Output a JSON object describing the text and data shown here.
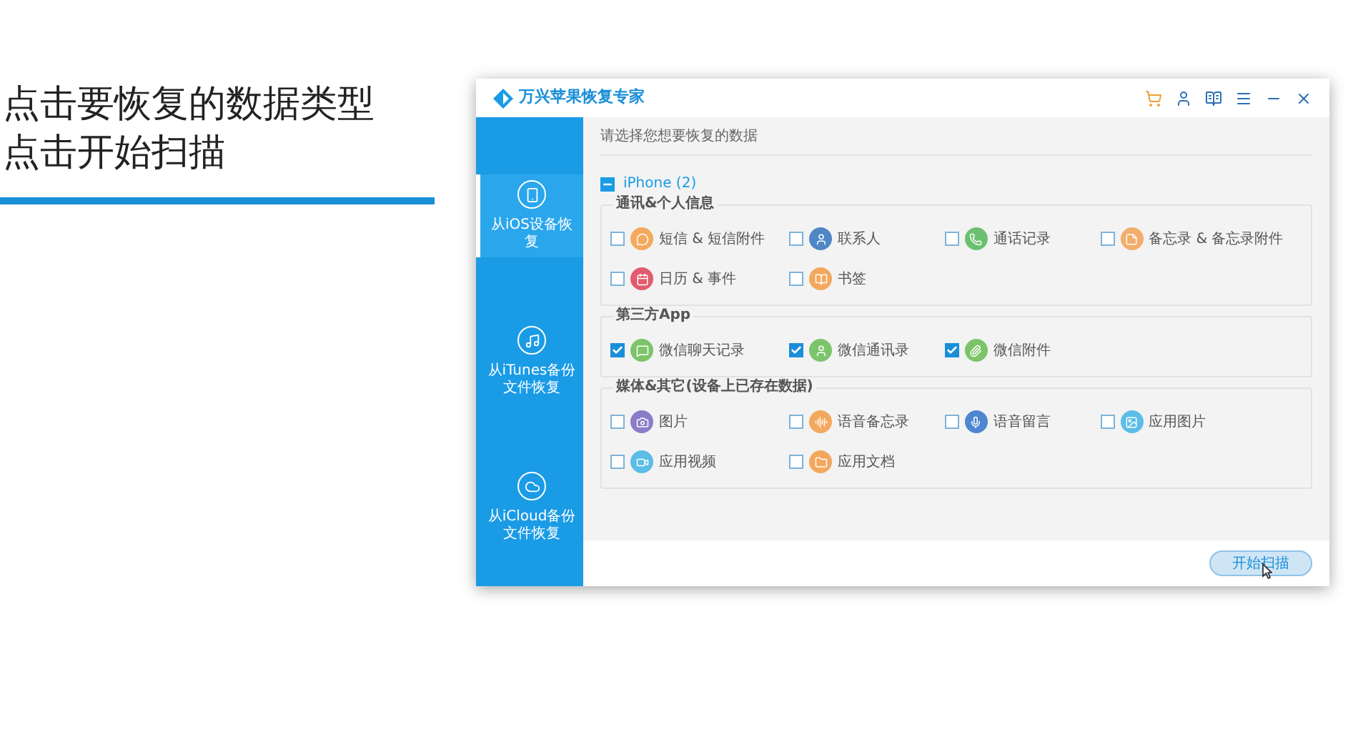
{
  "slide": {
    "lines": [
      "点击要恢复的数据类型",
      "点击开始扫描"
    ]
  },
  "window": {
    "title": "万兴苹果恢复专家"
  },
  "sidebar": {
    "items": [
      {
        "label": "从iOS设备恢复",
        "kind": "device",
        "selected": true
      },
      {
        "label": "从iTunes备份文件恢复",
        "kind": "music",
        "selected": false
      },
      {
        "label": "从iCloud备份文件恢复",
        "kind": "cloud",
        "selected": false
      }
    ]
  },
  "content": {
    "heading": "请选择您想要恢复的数据",
    "device": {
      "label": "iPhone (2)",
      "expanded": true
    },
    "groups": [
      {
        "title": "通讯&个人信息",
        "items": [
          {
            "label": "短信 & 短信附件",
            "kind": "message",
            "color": "#f4a95c",
            "checked": false
          },
          {
            "label": "联系人",
            "kind": "contact",
            "color": "#4f86c6",
            "checked": false
          },
          {
            "label": "通话记录",
            "kind": "phone",
            "color": "#6cc070",
            "checked": false
          },
          {
            "label": "备忘录 & 备忘录附件",
            "kind": "note",
            "color": "#f3ad6c",
            "checked": false
          },
          {
            "label": "日历 & 事件",
            "kind": "calendar",
            "color": "#e25b6c",
            "checked": false
          },
          {
            "label": "书签",
            "kind": "book",
            "color": "#f3a85e",
            "checked": false
          }
        ]
      },
      {
        "title": "第三方App",
        "items": [
          {
            "label": "微信聊天记录",
            "kind": "chat",
            "color": "#7cc46a",
            "checked": true
          },
          {
            "label": "微信通讯录",
            "kind": "contact",
            "color": "#7cc46a",
            "checked": true
          },
          {
            "label": "微信附件",
            "kind": "clip",
            "color": "#7cc46a",
            "checked": true
          }
        ]
      },
      {
        "title": "媒体&其它(设备上已存在数据)",
        "items": [
          {
            "label": "图片",
            "kind": "camera",
            "color": "#8b7cc9",
            "checked": false
          },
          {
            "label": "语音备忘录",
            "kind": "wave",
            "color": "#f3a85e",
            "checked": false
          },
          {
            "label": "语音留言",
            "kind": "mic",
            "color": "#4f86d0",
            "checked": false
          },
          {
            "label": "应用图片",
            "kind": "image",
            "color": "#5cbde6",
            "checked": false
          },
          {
            "label": "应用视频",
            "kind": "video",
            "color": "#5cbde6",
            "checked": false
          },
          {
            "label": "应用文档",
            "kind": "folder",
            "color": "#f3a85e",
            "checked": false
          }
        ]
      }
    ]
  },
  "scan_button": {
    "label": "开始扫描"
  }
}
